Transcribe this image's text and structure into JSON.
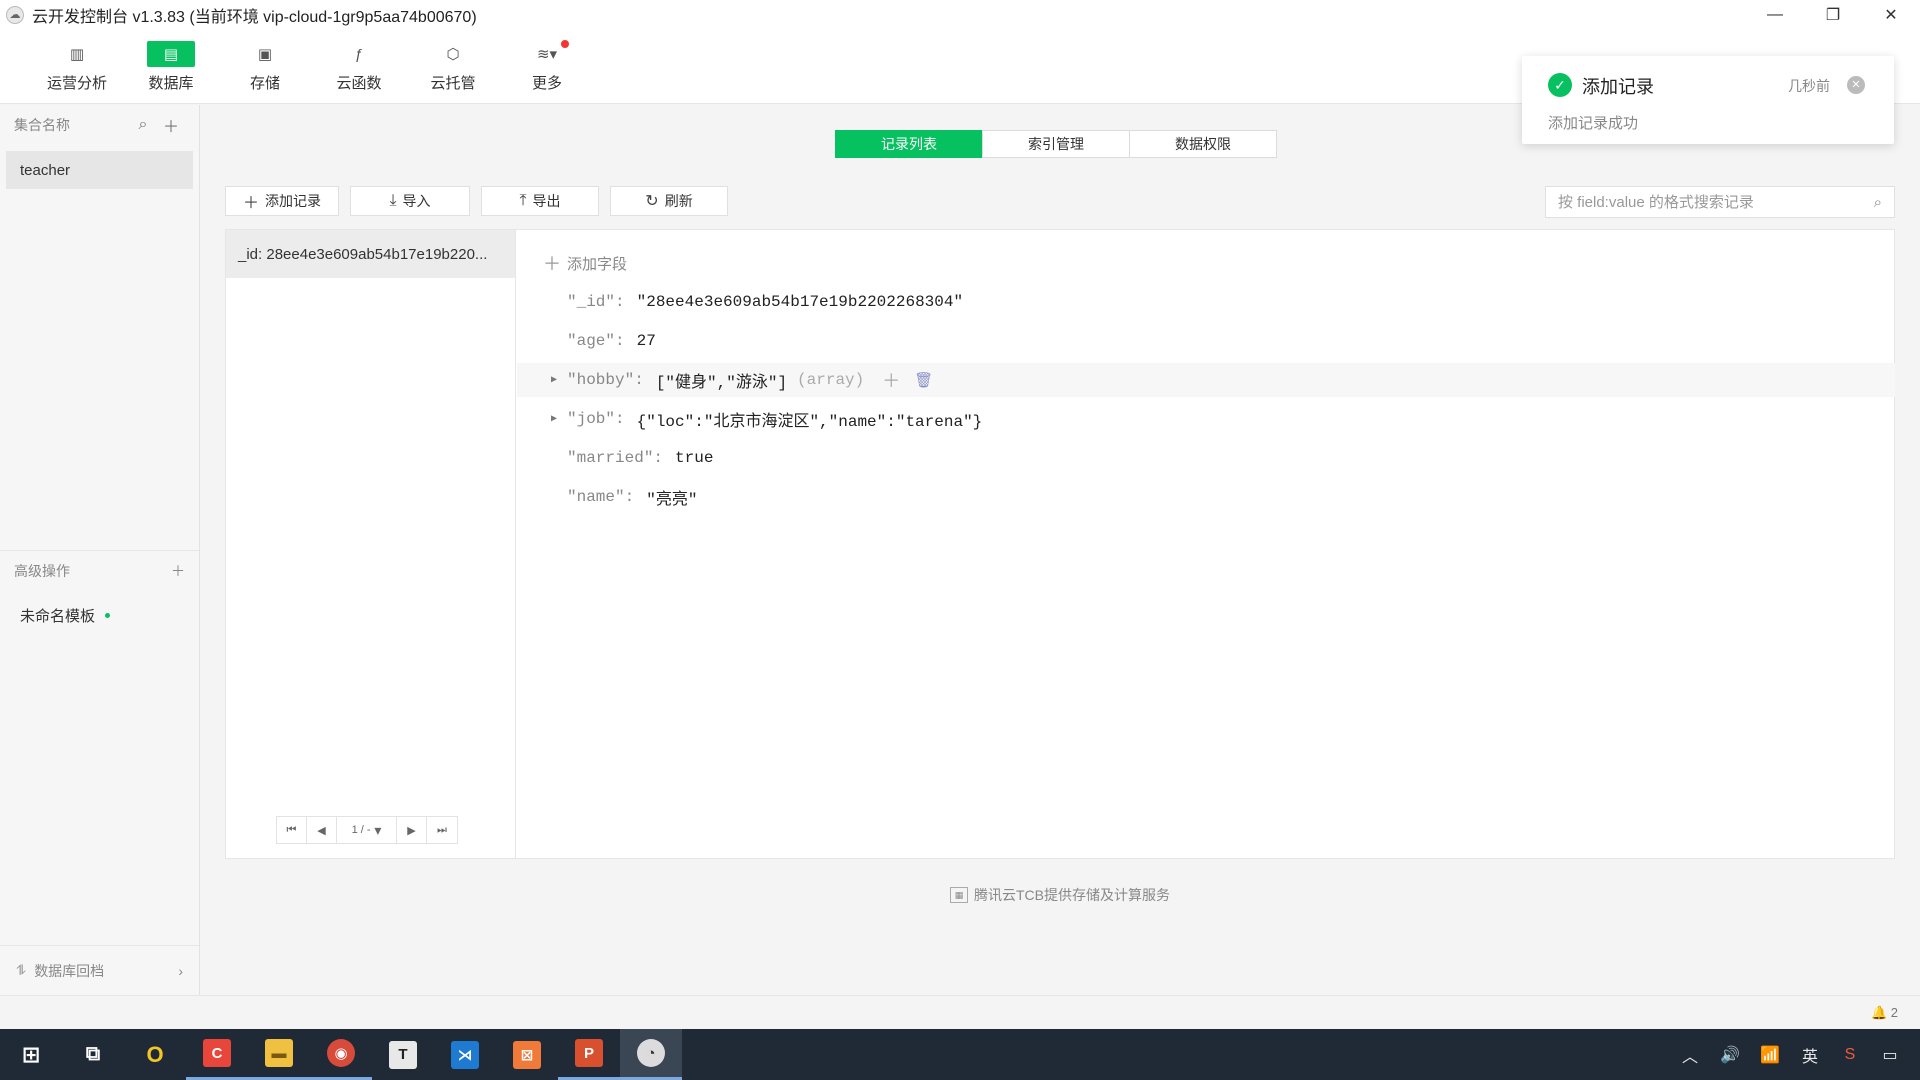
{
  "window": {
    "title": "云开发控制台 v1.3.83  (当前环境 vip-cloud-1gr9p5aa74b00670)",
    "controls": {
      "minimize": "—",
      "restore": "❐",
      "close": "✕"
    }
  },
  "toolbar": {
    "items": [
      {
        "label": "运营分析",
        "icon": "bar-chart-icon",
        "glyph": "▥"
      },
      {
        "label": "数据库",
        "icon": "database-icon",
        "glyph": "▤"
      },
      {
        "label": "存储",
        "icon": "storage-icon",
        "glyph": "▣"
      },
      {
        "label": "云函数",
        "icon": "cloud-function-icon",
        "glyph": "ƒ"
      },
      {
        "label": "云托管",
        "icon": "container-icon",
        "glyph": "⬡"
      },
      {
        "label": "更多",
        "icon": "layers-icon",
        "glyph": "≋▾"
      }
    ]
  },
  "sidebar": {
    "collections_header": "集合名称",
    "collections": [
      "teacher"
    ],
    "advanced_header": "高级操作",
    "template": "未命名模板",
    "rollback": "数据库回档"
  },
  "tabs": [
    "记录列表",
    "索引管理",
    "数据权限"
  ],
  "actions": {
    "add_record": "添加记录",
    "import": "导入",
    "export": "导出",
    "refresh": "刷新"
  },
  "search": {
    "placeholder": "按 field:value 的格式搜索记录"
  },
  "records": {
    "list": [
      "_id: 28ee4e3e609ab54b17e19b220..."
    ],
    "pager": "1 / -"
  },
  "detail": {
    "add_field": "添加字段",
    "fields": [
      {
        "key": "\"_id\"",
        "value": "\"28ee4e3e609ab54b17e19b2202268304\"",
        "expandable": false
      },
      {
        "key": "\"age\"",
        "value": "27",
        "expandable": false
      },
      {
        "key": "\"hobby\"",
        "value": "[\"健身\",\"游泳\"]",
        "type": "(array)",
        "expandable": true
      },
      {
        "key": "\"job\"",
        "value": "{\"loc\":\"北京市海淀区\",\"name\":\"tarena\"}",
        "expandable": true
      },
      {
        "key": "\"married\"",
        "value": "true",
        "expandable": false
      },
      {
        "key": "\"name\"",
        "value": "\"亮亮\"",
        "expandable": false
      }
    ]
  },
  "footer": "腾讯云TCB提供存储及计算服务",
  "status": {
    "notifications": "2"
  },
  "toast": {
    "title": "添加记录",
    "message": "添加记录成功",
    "time": "几秒前"
  },
  "taskbar": {
    "apps": [
      {
        "name": "start-icon",
        "glyph": "⊞",
        "bg": "transparent"
      },
      {
        "name": "task-view-icon",
        "glyph": "⧉",
        "bg": "transparent"
      },
      {
        "name": "browser-360-icon",
        "glyph": "O",
        "bg": "transparent"
      },
      {
        "name": "app-red-c-icon",
        "glyph": "C",
        "bg": "#e8463a"
      },
      {
        "name": "file-explorer-icon",
        "glyph": "▬",
        "bg": "#f0c040"
      },
      {
        "name": "chrome-icon",
        "glyph": "◉",
        "bg": "#d84a3a"
      },
      {
        "name": "typora-icon",
        "glyph": "T",
        "bg": "#e8e8e8"
      },
      {
        "name": "vscode-icon",
        "glyph": "⋊",
        "bg": "#1f7ad2"
      },
      {
        "name": "xampp-icon",
        "glyph": "⊠",
        "bg": "#f07a3a"
      },
      {
        "name": "powerpoint-icon",
        "glyph": "P",
        "bg": "#d9502f"
      },
      {
        "name": "wechat-devtools-icon",
        "glyph": "◔",
        "bg": "#dcdcdc"
      }
    ],
    "tray": {
      "lang": "英"
    }
  }
}
